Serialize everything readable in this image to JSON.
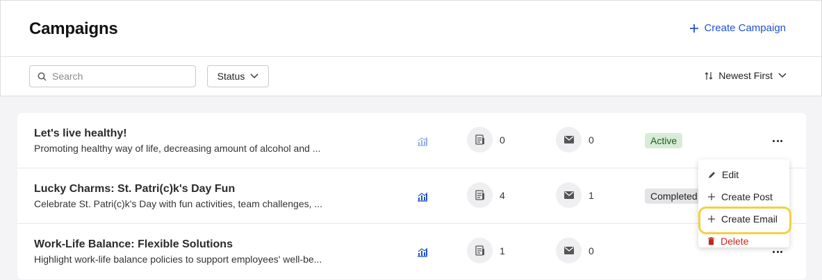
{
  "header": {
    "title": "Campaigns",
    "create_label": "Create Campaign"
  },
  "toolbar": {
    "search_placeholder": "Search",
    "status_label": "Status",
    "sort_label": "Newest First"
  },
  "campaigns": [
    {
      "title": "Let's live healthy!",
      "description": "Promoting healthy way of life, decreasing amount of alcohol and ...",
      "posts": "0",
      "emails": "0",
      "status": "Active"
    },
    {
      "title": "Lucky Charms: St. Patri(c)k's Day Fun",
      "description": "Celebrate St. Patri(c)k's Day with fun activities, team challenges, ...",
      "posts": "4",
      "emails": "1",
      "status": "Completed"
    },
    {
      "title": "Work-Life Balance: Flexible Solutions",
      "description": "Highlight work-life balance policies to support employees' well-be...",
      "posts": "1",
      "emails": "0",
      "status": ""
    }
  ],
  "menu": {
    "edit": "Edit",
    "create_post": "Create Post",
    "create_email": "Create Email",
    "delete": "Delete"
  },
  "colors": {
    "accent": "#1f52c9",
    "active_bg": "#d6ecd6",
    "delete": "#c0261d",
    "highlight": "#f4d040"
  },
  "icons": {
    "analytics": "bar-chart-icon",
    "posts": "document-icon",
    "emails": "envelope-icon",
    "more": "more-horizontal-icon"
  }
}
